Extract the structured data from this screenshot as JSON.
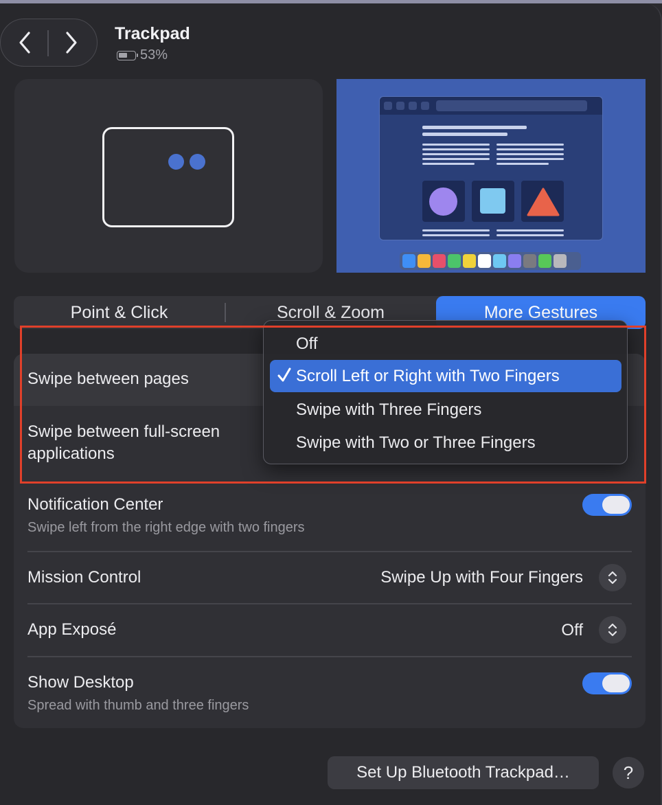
{
  "window": {
    "title": "Trackpad",
    "battery_level": "53%"
  },
  "tabs": [
    {
      "label": "Point & Click",
      "selected": false
    },
    {
      "label": "Scroll & Zoom",
      "selected": false
    },
    {
      "label": "More Gestures",
      "selected": true
    }
  ],
  "settings": {
    "swipe_pages": {
      "label": "Swipe between pages"
    },
    "swipe_fullscreen": {
      "label_line1": "Swipe between full-screen",
      "label_line2": "applications"
    },
    "notification_center": {
      "label": "Notification Center",
      "description": "Swipe left from the right edge with two fingers",
      "enabled": true
    },
    "mission_control": {
      "label": "Mission Control",
      "value": "Swipe Up with Four Fingers"
    },
    "app_expose": {
      "label": "App Exposé",
      "value": "Off"
    },
    "show_desktop": {
      "label": "Show Desktop",
      "description": "Spread with thumb and three fingers",
      "enabled": true
    }
  },
  "dropdown": {
    "options": [
      "Off",
      "Scroll Left or Right with Two Fingers",
      "Swipe with Three Fingers",
      "Swipe with Two or Three Fingers"
    ],
    "selected": "Scroll Left or Right with Two Fingers"
  },
  "footer": {
    "setup_button": "Set Up Bluetooth Trackpad…",
    "help_button": "?"
  },
  "colors": {
    "accent": "#3a7bf0",
    "highlight_border": "#e0402a",
    "background": "#28282c"
  }
}
